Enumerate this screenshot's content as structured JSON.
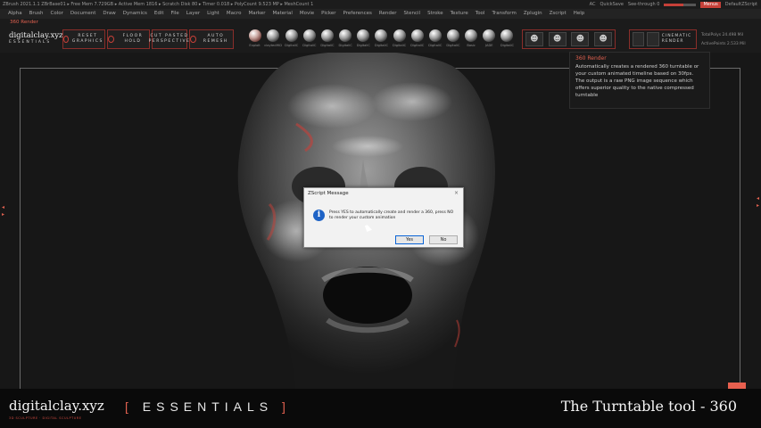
{
  "titlebar": {
    "left_text": "ZBrush 2021.1.1   ZBrBase01  ▸ Free Mem 7.729GB ▸ Active Mem 1816 ▸ Scratch Disk 80 ▸ Timer 0.018 ▸ PolyCount 9.523 MP ▸ MeshCount 1",
    "ac": "AC",
    "quicksave": "QuickSave",
    "see_through": "See-through 0",
    "menus": "Menus",
    "default_script": "DefaultZScript"
  },
  "menubar": [
    "Alpha",
    "Brush",
    "Color",
    "Document",
    "Draw",
    "Dynamics",
    "Edit",
    "File",
    "Layer",
    "Light",
    "Macro",
    "Marker",
    "Material",
    "Movie",
    "Picker",
    "Preferences",
    "Render",
    "Stencil",
    "Stroke",
    "Texture",
    "Tool",
    "Transform",
    "Zplugin",
    "Zscript",
    "Help"
  ],
  "shelf": {
    "render_label": "360 Render",
    "logo_main": "digitalclay.xyz",
    "logo_sub": "ESSENTIALS",
    "buttons": {
      "reset_graphics": "RESET GRAPHICS",
      "floor_hold": "FLOOR HOLD",
      "cut_pasted": "CUT PASTED PERSPECTIVE",
      "auto_remesh": "AUTO REMESH"
    },
    "matcaps": [
      "Exploit",
      "claytecMiD",
      "DigitaliC",
      "DigitaliC",
      "DigitaliC",
      "DigitaliC",
      "DigitaliC",
      "DigitaliC",
      "DigitaliC",
      "DigitaliC",
      "DigitaliC",
      "DigitaliC",
      "Basic",
      "JADE",
      "DigitaliC"
    ],
    "cinematic_render": "CINEMATIC RENDER",
    "totalpolys": "TotalPolys 24.498 Mil",
    "activepoints": "ActivePoints 2.533 Mil"
  },
  "tooltip": {
    "title": "360 Render",
    "body": "Automatically creates a rendered 360 turntable or your custom animated timeline based on 30fps. The output is a raw PNG image sequence which offers superior quality to the native compressed turntable"
  },
  "dialog": {
    "title": "ZScript Message",
    "close": "×",
    "message": "Press YES to automatically create and render a 360, press NO to render your custom animation",
    "yes_label": "Yes",
    "no_label": "No"
  },
  "overlay": {
    "brand": "digitalclay.xyz",
    "brand_sub": "3D SCULPTURE · DIGITAL SCULPTURE",
    "essentials_open": "[",
    "essentials_word": "ESSENTIALS",
    "essentials_close": "]",
    "video_title": "The Turntable tool - 360"
  },
  "colors": {
    "accent": "#e0604f",
    "accent_dark": "#8a2e2a",
    "background": "#171717",
    "dialog_bg": "#f2f2f2",
    "info_icon": "#1e63c6"
  }
}
